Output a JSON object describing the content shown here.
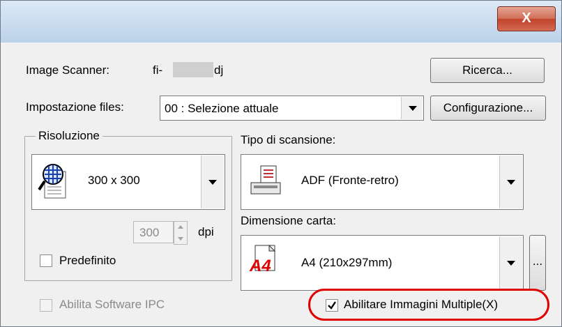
{
  "window": {
    "close_label": "X"
  },
  "scanner": {
    "label": "Image Scanner:",
    "model_prefix": "fi-",
    "model_suffix": "dj",
    "search_button": "Ricerca..."
  },
  "file_settings": {
    "label": "Impostazione files:",
    "selected": "00 : Selezione attuale",
    "config_button": "Configurazione..."
  },
  "resolution": {
    "group_label": "Risoluzione",
    "selected": "300 x 300",
    "dpi_value": "300",
    "dpi_unit": "dpi",
    "default_label": "Predefinito",
    "default_checked": false
  },
  "scan_type": {
    "label": "Tipo di scansione:",
    "selected": "ADF (Fronte-retro)"
  },
  "paper_size": {
    "label": "Dimensione carta:",
    "selected": "A4 (210x297mm)",
    "icon_text": "A4",
    "more_button": "..."
  },
  "options": {
    "ipc_label": "Abilita Software IPC",
    "ipc_checked": false,
    "multi_image_label": "Abilitare Immagini Multiple(X)",
    "multi_image_checked": true
  },
  "colors": {
    "highlight": "#e00000",
    "title_gradient_top": "#dce9f6"
  }
}
